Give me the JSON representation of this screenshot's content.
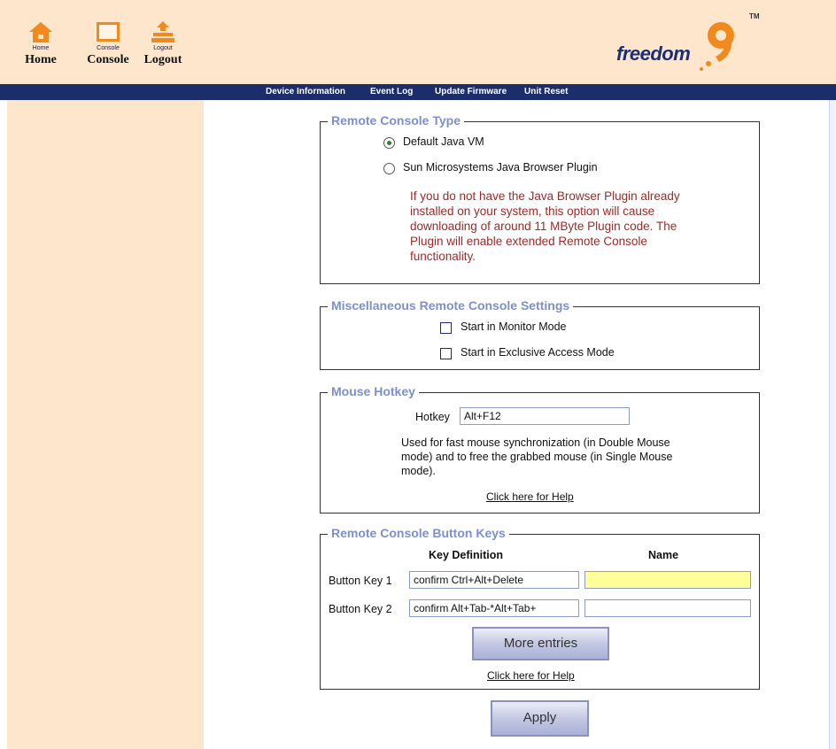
{
  "header": {
    "home": {
      "small": "Home",
      "label": "Home"
    },
    "console": {
      "small": "Console",
      "label": "Console"
    },
    "logout": {
      "small": "Logout",
      "label": "Logout"
    },
    "logo_text": "freedom",
    "logo_tm": "TM"
  },
  "menu": [
    "Device Information",
    "Event Log",
    "Update Firmware",
    "Unit Reset"
  ],
  "remote_console_type": {
    "legend": "Remote Console Type",
    "option_default": "Default Java VM",
    "option_plugin": "Sun Microsystems Java Browser Plugin",
    "selected": "Default Java VM",
    "warning": "If you do not have the Java Browser Plugin already installed on your system, this option will cause downloading of around 11 MByte Plugin code. The Plugin will enable extended Remote Console functionality."
  },
  "misc_settings": {
    "legend": "Miscellaneous Remote Console Settings",
    "monitor_mode": "Start in Monitor Mode",
    "exclusive_mode": "Start in Exclusive Access Mode"
  },
  "mouse_hotkey": {
    "legend": "Mouse Hotkey",
    "label": "Hotkey",
    "value": "Alt+F12",
    "description": "Used for fast mouse synchronization (in Double Mouse mode) and to free the grabbed mouse (in Single Mouse mode).",
    "help_link": "Click here for Help"
  },
  "button_keys": {
    "legend": "Remote Console Button Keys",
    "col_definition": "Key Definition",
    "col_name": "Name",
    "rows": [
      {
        "label": "Button Key 1",
        "definition": "confirm Ctrl+Alt+Delete",
        "name": ""
      },
      {
        "label": "Button Key 2",
        "definition": "confirm Alt+Tab-*Alt+Tab+",
        "name": ""
      }
    ],
    "more_entries": "More entries",
    "help_link": "Click here for Help"
  },
  "apply_label": "Apply",
  "colors": {
    "header_bg": "#fde6cc",
    "menubar_bg": "#1b2e6b",
    "legend": "#7d8fcc",
    "warning": "#a02a2a",
    "highlight_input": "#ffff99",
    "logo_orange": "#f08a1c"
  }
}
